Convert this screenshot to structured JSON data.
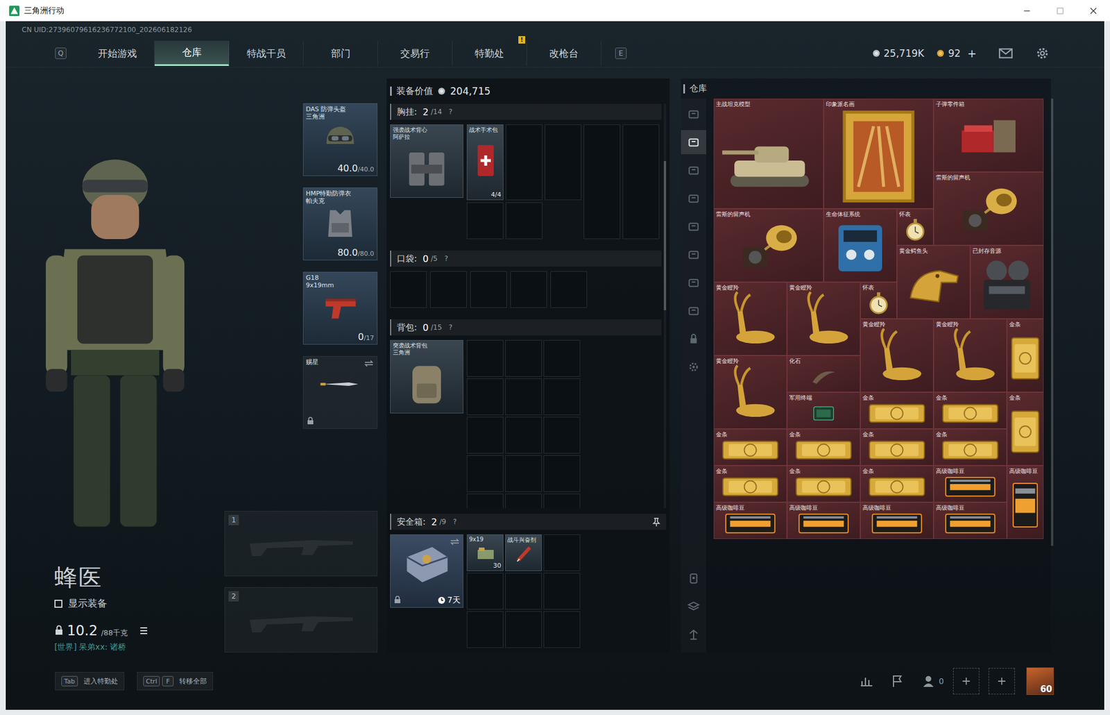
{
  "window": {
    "title": "三角洲行动"
  },
  "uid": "CN UID:27396079616236772100_202606182126",
  "nav": {
    "left_key": "Q",
    "right_key": "E",
    "tabs": [
      {
        "label": "开始游戏",
        "selected": false
      },
      {
        "label": "仓库",
        "selected": true
      },
      {
        "label": "特战干员",
        "selected": false
      },
      {
        "label": "部门",
        "selected": false
      },
      {
        "label": "交易行",
        "selected": false
      },
      {
        "label": "特勤处",
        "selected": false,
        "badge": "!"
      },
      {
        "label": "改枪台",
        "selected": false
      }
    ],
    "currencies": [
      {
        "value": "25,719K",
        "kind": "silver"
      },
      {
        "value": "92",
        "kind": "gold",
        "add": "+"
      }
    ]
  },
  "character": {
    "name": "蜂医",
    "show_gear": {
      "label": "显示装备",
      "checked": false
    },
    "weight": "10.2",
    "capacity": "/88千克",
    "chat": "[世界] 呆弟xx: 诸桥"
  },
  "equipment": [
    {
      "name": "DAS 防弹头盔",
      "sub": "三角洲",
      "reading": "40.0",
      "max": "/40.0",
      "kind": "helmet"
    },
    {
      "name": "HMP特勤防弹衣",
      "sub": "帕夫克",
      "reading": "80.0",
      "max": "/80.0",
      "kind": "armor"
    },
    {
      "name": "G18",
      "sub": "9x19mm",
      "reading": "0",
      "max": "/17",
      "kind": "pistol"
    },
    {
      "name": "赐星",
      "kind": "knife",
      "locked": true
    }
  ],
  "weapon_slots": [
    {
      "number": "1"
    },
    {
      "number": "2"
    }
  ],
  "loadout": {
    "value_label": "装备价值",
    "value": "204,715",
    "chest": {
      "label": "胸挂:",
      "count": "2",
      "capacity": "/14",
      "help": "?",
      "rig": {
        "name": "强袭战术背心",
        "sub": "阿萨拉"
      },
      "items": [
        {
          "name": "战术手术包",
          "count": "4/4"
        }
      ]
    },
    "pockets": {
      "label": "口袋:",
      "count": "0",
      "capacity": "/5",
      "help": "?"
    },
    "backpack": {
      "label": "背包:",
      "count": "0",
      "capacity": "/15",
      "help": "?",
      "bag": {
        "name": "突袭战术背包",
        "sub": "三角洲"
      }
    },
    "safe": {
      "label": "安全箱:",
      "count": "2",
      "capacity": "/9",
      "help": "?",
      "timer": "7天",
      "items": [
        {
          "name": "9x19",
          "count": "30"
        },
        {
          "name": "战斗兴奋剂"
        }
      ]
    }
  },
  "warehouse": {
    "title": "仓库",
    "side_tabs": [
      {
        "selected": false
      },
      {
        "selected": true
      },
      {
        "selected": false
      },
      {
        "selected": false
      },
      {
        "selected": false
      },
      {
        "selected": false
      },
      {
        "selected": false
      },
      {
        "selected": false
      }
    ],
    "items": [
      {
        "name": "主战坦克模型",
        "kind": "tank"
      },
      {
        "name": "印象派名画",
        "kind": "painting"
      },
      {
        "name": "子弹零件箱",
        "kind": "box"
      },
      {
        "name": "雷斯的留声机",
        "kind": "phonograph"
      },
      {
        "name": "雷斯的留声机",
        "kind": "phonograph"
      },
      {
        "name": "生命体征系统",
        "kind": "device"
      },
      {
        "name": "怀表",
        "kind": "watch"
      },
      {
        "name": "黄金鳄鱼头",
        "kind": "croc"
      },
      {
        "name": "已封存音源",
        "kind": "recorder"
      },
      {
        "name": "黄金瞪羚",
        "kind": "gazelle"
      },
      {
        "name": "黄金瞪羚",
        "kind": "gazelle"
      },
      {
        "name": "怀表",
        "kind": "watch"
      },
      {
        "name": "黄金瞪羚",
        "kind": "gazelle"
      },
      {
        "name": "黄金瞪羚",
        "kind": "gazelle"
      },
      {
        "name": "金条",
        "kind": "gold"
      },
      {
        "name": "黄金瞪羚",
        "kind": "gazelle"
      },
      {
        "name": "化石",
        "kind": "fossil"
      },
      {
        "name": "军用终端",
        "kind": "terminal"
      },
      {
        "name": "金条",
        "kind": "gold"
      },
      {
        "name": "金条",
        "kind": "gold"
      },
      {
        "name": "金条",
        "kind": "gold"
      },
      {
        "name": "金条",
        "kind": "gold"
      },
      {
        "name": "金条",
        "kind": "gold"
      },
      {
        "name": "金条",
        "kind": "gold"
      },
      {
        "name": "金条",
        "kind": "gold"
      },
      {
        "name": "金条",
        "kind": "gold"
      },
      {
        "name": "金条",
        "kind": "gold"
      },
      {
        "name": "金条",
        "kind": "gold"
      },
      {
        "name": "高级咖啡豆",
        "kind": "coffee"
      },
      {
        "name": "高级咖啡豆",
        "kind": "coffee"
      },
      {
        "name": "高级咖啡豆",
        "kind": "coffee"
      },
      {
        "name": "高级咖啡豆",
        "kind": "coffee"
      },
      {
        "name": "高级咖啡豆",
        "kind": "coffee"
      },
      {
        "name": "高级咖啡豆",
        "kind": "coffee"
      }
    ]
  },
  "hints": [
    {
      "keys": [
        "Tab"
      ],
      "label": "进入特勤处"
    },
    {
      "keys": [
        "Ctrl",
        "F"
      ],
      "label": "转移全部"
    }
  ],
  "footer": {
    "friends": "0",
    "level": "60"
  }
}
